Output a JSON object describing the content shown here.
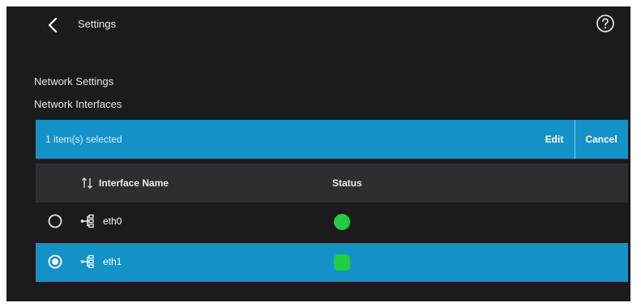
{
  "header": {
    "back_icon": "chevron-left-icon",
    "title": "Settings",
    "help_icon": "question-circle-icon"
  },
  "section": {
    "title": "Network Settings",
    "subtitle": "Network Interfaces"
  },
  "selection_bar": {
    "text": "1 item(s) selected",
    "edit_label": "Edit",
    "cancel_label": "Cancel"
  },
  "table": {
    "columns": {
      "sort_icon": "sort-arrows-icon",
      "name": "Interface Name",
      "status": "Status"
    },
    "rows": [
      {
        "name": "eth0",
        "selected": false,
        "status_color": "#22cc44",
        "icon": "network-tree-icon"
      },
      {
        "name": "eth1",
        "selected": true,
        "status_color": "#22cc44",
        "icon": "network-tree-icon"
      }
    ]
  },
  "colors": {
    "accent": "#1492c8",
    "background": "#1b1b1d",
    "header_row": "#2e2e31",
    "status_ok": "#22cc44"
  }
}
